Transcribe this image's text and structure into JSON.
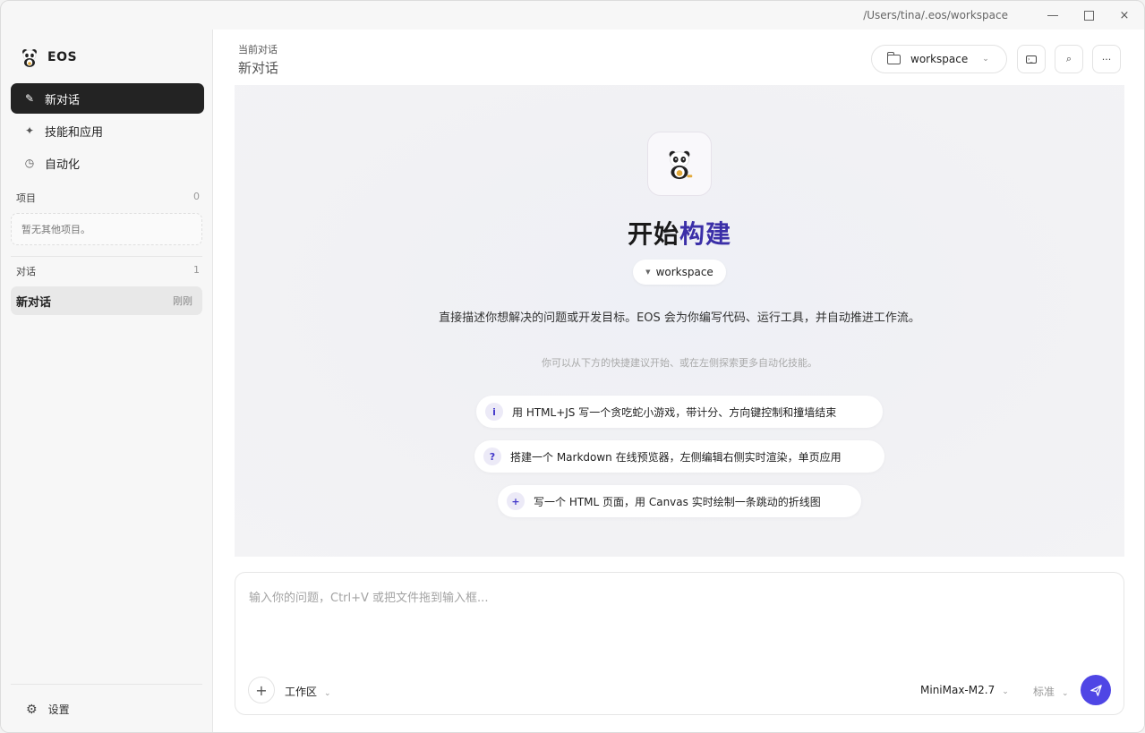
{
  "titlebar": {
    "path": "/Users/tina/.eos/workspace",
    "close": "×"
  },
  "sidebar": {
    "brand": "EOS",
    "nav": [
      {
        "label": "新对话",
        "icon": "✎"
      },
      {
        "label": "技能和应用",
        "icon": "✦"
      },
      {
        "label": "自动化",
        "icon": "◷"
      }
    ],
    "projects": {
      "title": "项目",
      "count": "0",
      "empty": "暂无其他项目。"
    },
    "conversations": {
      "title": "对话",
      "count": "1",
      "items": [
        {
          "title": "新对话",
          "time": "刚刚"
        }
      ]
    },
    "settings": {
      "label": "设置",
      "icon": "⚙"
    }
  },
  "header": {
    "subtitle": "当前对话",
    "title": "新对话",
    "workspace": "workspace",
    "search_icon": "⌕",
    "more_icon": "···"
  },
  "hero": {
    "title_part1": "开始",
    "title_part2": "构建",
    "workspace": "workspace",
    "description": "直接描述你想解决的问题或开发目标。EOS 会为你编写代码、运行工具，并自动推进工作流。",
    "hint": "你可以从下方的快捷建议开始、或在左侧探索更多自动化技能。",
    "suggestions": [
      {
        "badge": "i",
        "text": "用 HTML+JS 写一个贪吃蛇小游戏，带计分、方向键控制和撞墙结束"
      },
      {
        "badge": "?",
        "text": "搭建一个 Markdown 在线预览器，左侧编辑右侧实时渲染，单页应用"
      },
      {
        "badge": "+",
        "text": "写一个 HTML 页面，用 Canvas 实时绘制一条跳动的折线图"
      }
    ]
  },
  "composer": {
    "placeholder": "输入你的问题，Ctrl+V 或把文件拖到输入框...",
    "plus": "+",
    "workarea": "工作区",
    "model": "MiniMax-M2.7",
    "mode": "标准"
  },
  "colors": {
    "accent": "#4f46e5",
    "title_accent": "#3b2fa8",
    "active_nav": "#232323"
  }
}
